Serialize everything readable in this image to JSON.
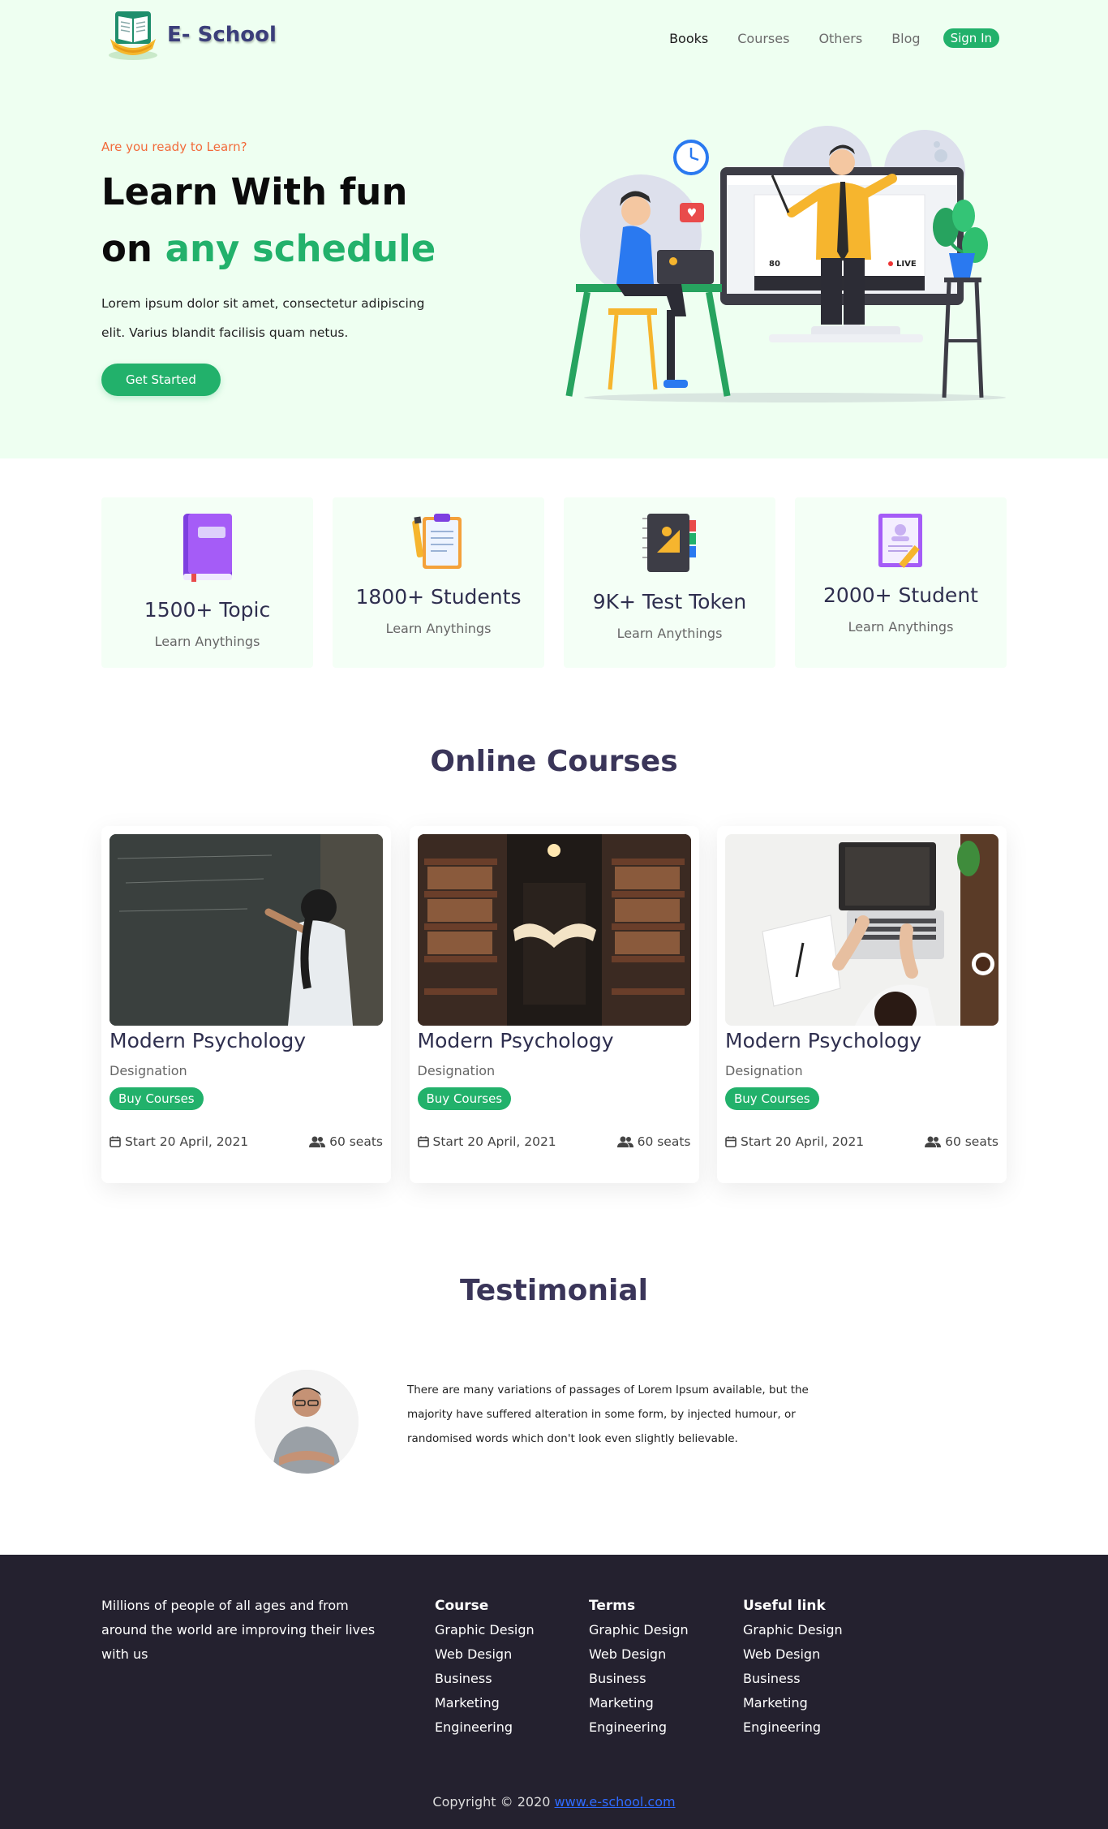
{
  "nav": {
    "brand": "E- School",
    "links": [
      "Books",
      "Courses",
      "Others",
      "Blog"
    ],
    "signin": "Sign In"
  },
  "hero": {
    "eyebrow": "Are you ready to Learn?",
    "title_line1": "Learn With fun",
    "title_line2_prefix": "on ",
    "title_line2_highlight": "any schedule",
    "paragraph": "Lorem ipsum dolor sit amet, consectetur adipiscing elit. Varius blandit facilisis quam netus.",
    "cta": "Get Started",
    "live_count": "80",
    "live_label": "LIVE"
  },
  "stats": [
    {
      "value": "1500+ Topic",
      "sub": "Learn Anythings",
      "icon": "book-icon"
    },
    {
      "value": "1800+ Students",
      "sub": "Learn Anythings",
      "icon": "clipboard-icon"
    },
    {
      "value": "9K+ Test Token",
      "sub": "Learn Anythings",
      "icon": "notebook-icon"
    },
    {
      "value": "2000+ Student",
      "sub": "Learn Anythings",
      "icon": "certificate-icon"
    }
  ],
  "courses": {
    "title": "Online Courses",
    "items": [
      {
        "title": "Modern Psychology",
        "designation": "Designation",
        "button": "Buy Courses",
        "date": "Start 20 April, 2021",
        "seats": "60 seats"
      },
      {
        "title": "Modern Psychology",
        "designation": "Designation",
        "button": "Buy Courses",
        "date": "Start 20 April, 2021",
        "seats": "60 seats"
      },
      {
        "title": "Modern Psychology",
        "designation": "Designation",
        "button": "Buy Courses",
        "date": "Start 20 April, 2021",
        "seats": "60 seats"
      }
    ]
  },
  "testimonial": {
    "title": "Testimonial",
    "quote": "There are many variations of passages of Lorem Ipsum available, but the majority have suffered alteration in some form, by injected humour, or randomised words which don't look even slightly believable."
  },
  "footer": {
    "about": "Millions of people of all ages and from around the world are improving their lives with us",
    "columns": [
      {
        "title": "Course",
        "links": [
          "Graphic Design",
          "Web Design",
          "Business",
          "Marketing",
          "Engineering"
        ]
      },
      {
        "title": "Terms",
        "links": [
          "Graphic Design",
          "Web Design",
          "Business",
          "Marketing",
          "Engineering"
        ]
      },
      {
        "title": "Useful link",
        "links": [
          "Graphic Design",
          "Web Design",
          "Business",
          "Marketing",
          "Engineering"
        ]
      }
    ],
    "copyright_text": "Copyright © 2020 ",
    "copyright_link": "www.e-school.com"
  },
  "colors": {
    "accent": "#22b16b",
    "hero_bg": "#eefff1",
    "eyebrow": "#f26b3a",
    "heading": "#3a3559",
    "footer_bg": "#24212f",
    "link": "#2f6bff"
  }
}
